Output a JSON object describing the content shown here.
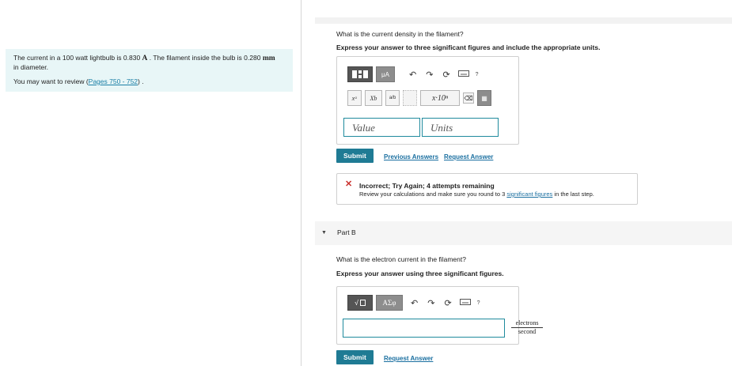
{
  "problem": {
    "text_prefix": "The current in a 100 watt lightbulb is 0.830 ",
    "current_unit": "A",
    "text_middle": " . The filament inside the bulb is 0.280 ",
    "diameter_unit": "mm",
    "text_suffix": "in diameter.",
    "review_prefix": "You may want to review (",
    "review_link": "Pages 750 - 752",
    "review_suffix": ") ."
  },
  "partA": {
    "question": "What is the current density in the filament?",
    "instruction": "Express your answer to three significant figures and include the appropriate units.",
    "toolbar": {
      "mu_a": "μA",
      "x_power": "xᵃ",
      "x_sub": "Xb",
      "fraction": "a/b",
      "sci": "x·10ⁿ",
      "help": "?"
    },
    "value_placeholder": "Value",
    "units_placeholder": "Units",
    "submit_label": "Submit",
    "previous_answers_label": "Previous Answers",
    "request_answer_label": "Request Answer",
    "feedback": {
      "title": "Incorrect; Try Again; 4 attempts remaining",
      "message_prefix": "Review your calculations and make sure you round to 3 ",
      "message_link": "significant figures",
      "message_suffix": " in the last step."
    }
  },
  "partB": {
    "title": "Part B",
    "question": "What is the electron current in the filament?",
    "instruction": "Express your answer using three significant figures.",
    "toolbar": {
      "sqrt": "√",
      "greek": "ΑΣφ",
      "help": "?"
    },
    "answer_value": "",
    "unit_numerator": "electrons",
    "unit_denominator": "second",
    "submit_label": "Submit",
    "request_answer_label": "Request Answer"
  },
  "colors": {
    "accent": "#1f7b94",
    "problem_bg": "#e8f6f7",
    "error": "#c9302c",
    "link": "#1a6fa0"
  }
}
